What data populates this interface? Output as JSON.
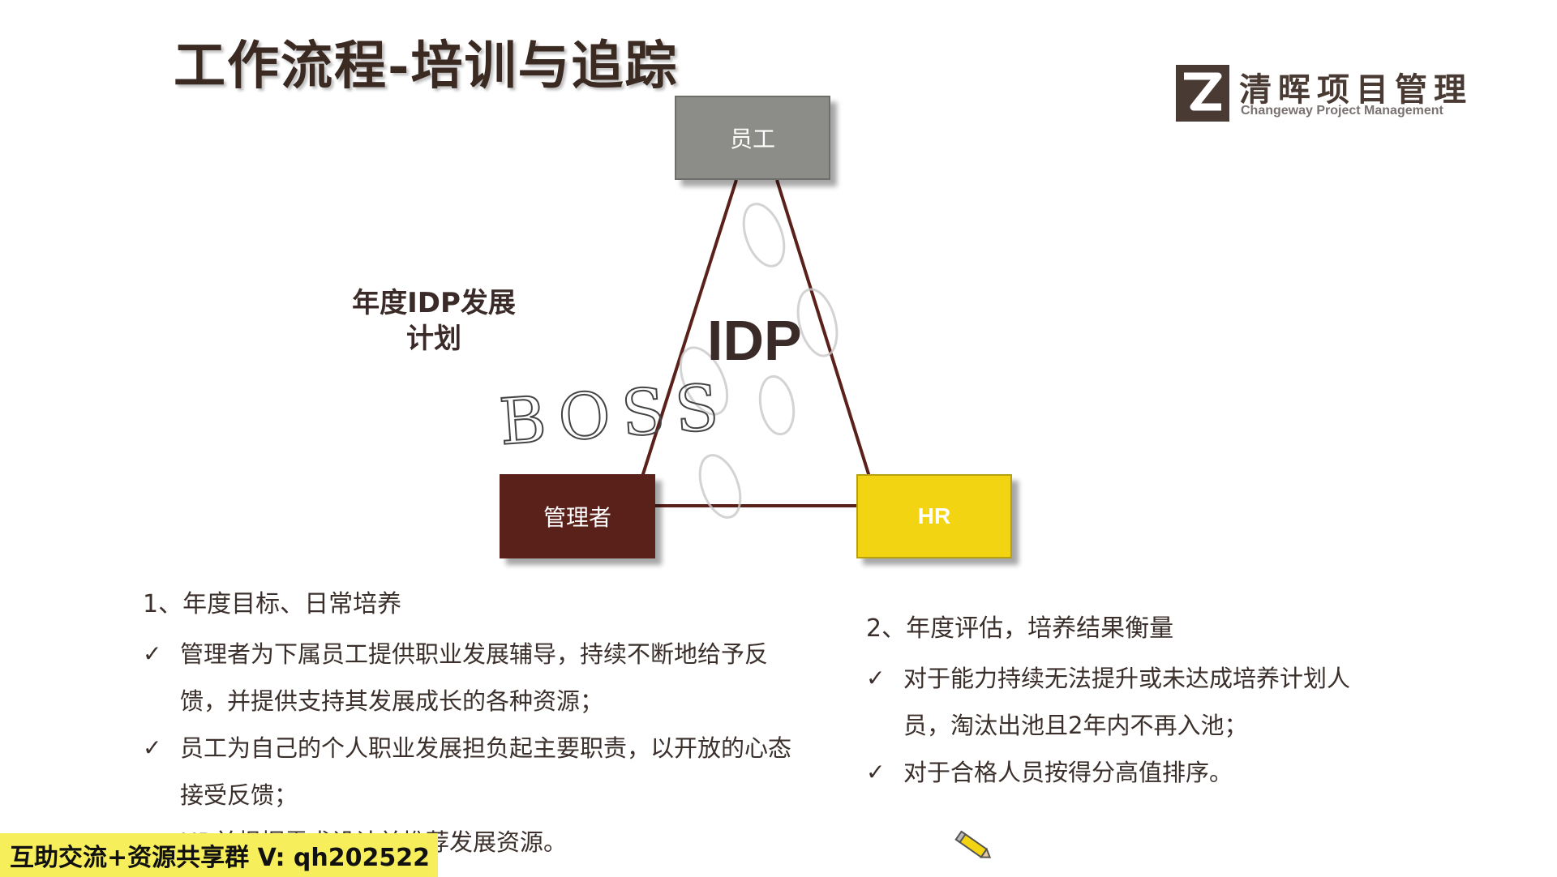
{
  "title": "工作流程-培训与追踪",
  "logo": {
    "name_cn": "清晖项目管理",
    "name_en": "Changeway Project Management",
    "icon": "z-letter-logo-icon"
  },
  "diagram": {
    "center_label": "IDP",
    "side_label_line1": "年度IDP发展",
    "side_label_line2": "计划",
    "nodes": {
      "employee": "员工",
      "manager": "管理者",
      "hr": "HR"
    },
    "handwriting": "BOSS",
    "colors": {
      "employee": "#8c8d88",
      "manager": "#5a211b",
      "hr": "#f2d413",
      "edges": "#5a211b"
    }
  },
  "section1": {
    "heading": "1、年度目标、日常培养",
    "bullets": [
      "管理者为下属员工提供职业发展辅导，持续不断地给予反馈，并提供支持其发展成长的各种资源；",
      "员工为自己的个人职业发展担负起主要职责，以开放的心态接受反馈；",
      "HR并根据需求设计并推荐发展资源。"
    ]
  },
  "section2": {
    "heading": "2、年度评估，培养结果衡量",
    "bullets": [
      "对于能力持续无法提升或未达成培养计划人员，淘汰出池且2年内不再入池；",
      "对于合格人员按得分高值排序。"
    ]
  },
  "banner": {
    "text": "互助交流+资源共享群 V: qh202522",
    "color": "#f6ee5a"
  },
  "pencil_icon": "pencil-icon"
}
